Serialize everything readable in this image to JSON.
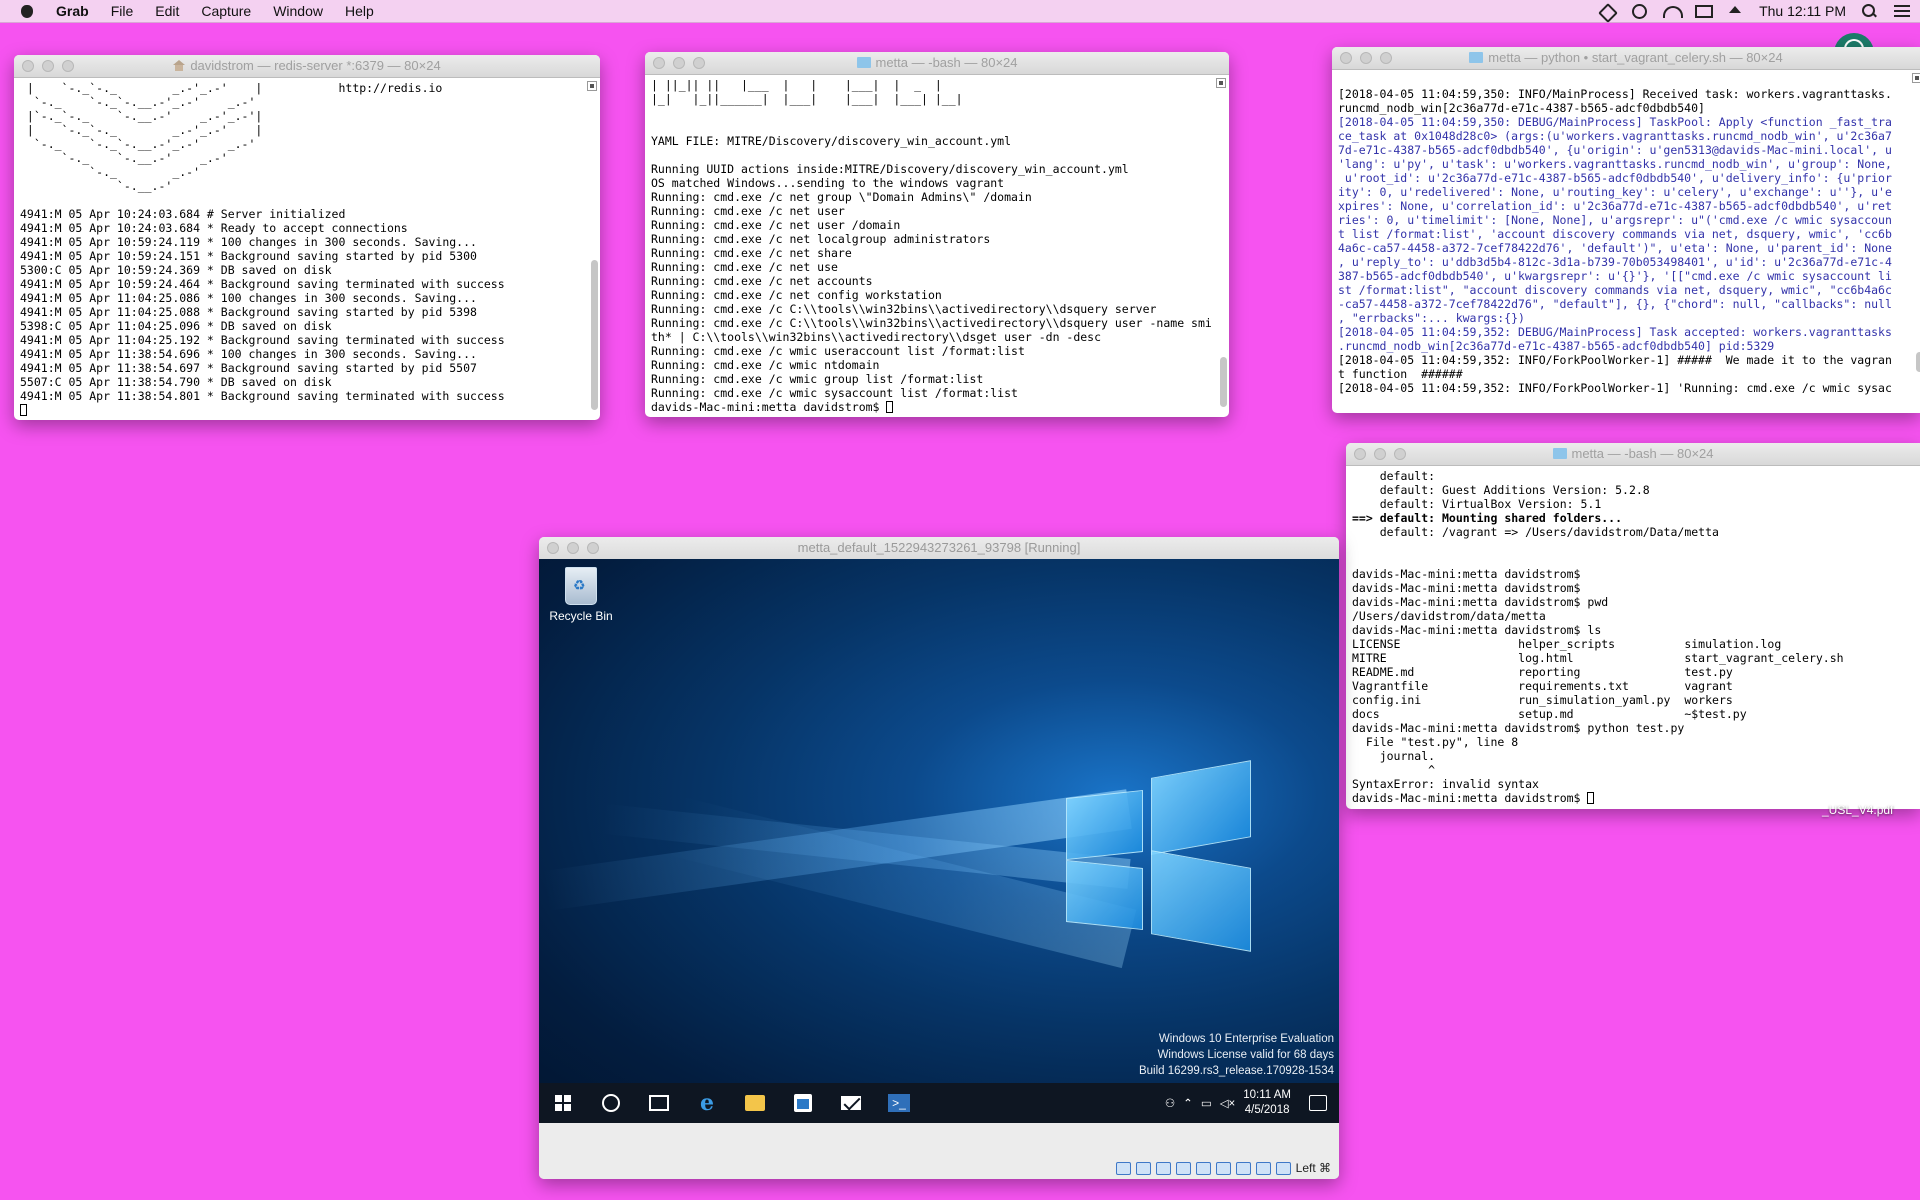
{
  "menubar": {
    "app_name": "Grab",
    "items": [
      "File",
      "Edit",
      "Capture",
      "Window",
      "Help"
    ],
    "clock": "Thu 12:11 PM"
  },
  "redis_window": {
    "title": "davidstrom — redis-server *:6379 — 80×24",
    "lines": [
      " |    `-._`-._        _.-'_.-'    |           http://redis.io        ",
      "  `-._    `-._`-.__.-'_.-'    _.-'",
      " |`-._`-._    `-.__.-'    _.-'_.-'|",
      " |    `-._`-._        _.-'_.-'    |",
      "  `-._    `-._`-.__.-'_.-'    _.-'",
      "      `-._    `-.__.-'    _.-'",
      "          `-._        _.-'",
      "              `-.__.-'",
      "",
      "4941:M 05 Apr 10:24:03.684 # Server initialized",
      "4941:M 05 Apr 10:24:03.684 * Ready to accept connections",
      "4941:M 05 Apr 10:59:24.119 * 100 changes in 300 seconds. Saving...",
      "4941:M 05 Apr 10:59:24.151 * Background saving started by pid 5300",
      "5300:C 05 Apr 10:59:24.369 * DB saved on disk",
      "4941:M 05 Apr 10:59:24.464 * Background saving terminated with success",
      "4941:M 05 Apr 11:04:25.086 * 100 changes in 300 seconds. Saving...",
      "4941:M 05 Apr 11:04:25.088 * Background saving started by pid 5398",
      "5398:C 05 Apr 11:04:25.096 * DB saved on disk",
      "4941:M 05 Apr 11:04:25.192 * Background saving terminated with success",
      "4941:M 05 Apr 11:38:54.696 * 100 changes in 300 seconds. Saving...",
      "4941:M 05 Apr 11:38:54.697 * Background saving started by pid 5507",
      "5507:C 05 Apr 11:38:54.790 * DB saved on disk",
      "4941:M 05 Apr 11:38:54.801 * Background saving terminated with success"
    ]
  },
  "bash_window_1": {
    "title": "metta — -bash — 80×24",
    "lines": [
      "| ||_|| ||   |___  |   |    |___|  |  _  |",
      "|_|   |_||______|  |___|    |___|  |___| |__|",
      "",
      "",
      "YAML FILE: MITRE/Discovery/discovery_win_account.yml",
      "",
      "Running UUID actions inside:MITRE/Discovery/discovery_win_account.yml",
      "OS matched Windows...sending to the windows vagrant",
      "Running: cmd.exe /c net group \\\"Domain Admins\\\" /domain",
      "Running: cmd.exe /c net user",
      "Running: cmd.exe /c net user /domain",
      "Running: cmd.exe /c net localgroup administrators",
      "Running: cmd.exe /c net share",
      "Running: cmd.exe /c net use",
      "Running: cmd.exe /c net accounts",
      "Running: cmd.exe /c net config workstation",
      "Running: cmd.exe /c C:\\\\tools\\\\win32bins\\\\activedirectory\\\\dsquery server",
      "Running: cmd.exe /c C:\\\\tools\\\\win32bins\\\\activedirectory\\\\dsquery user -name smi",
      "th* | C:\\\\tools\\\\win32bins\\\\activedirectory\\\\dsget user -dn -desc",
      "Running: cmd.exe /c wmic useraccount list /format:list",
      "Running: cmd.exe /c wmic ntdomain",
      "Running: cmd.exe /c wmic group list /format:list",
      "Running: cmd.exe /c wmic sysaccount list /format:list"
    ],
    "prompt": "davids-Mac-mini:metta davidstrom$ "
  },
  "python_window": {
    "title": "metta — python • start_vagrant_celery.sh — 80×24",
    "lines": [
      {
        "t": "",
        "c": ""
      },
      {
        "t": "[2018-04-05 11:04:59,350: INFO/MainProcess] Received task: workers.vagranttasks.",
        "c": ""
      },
      {
        "t": "runcmd_nodb_win[2c36a77d-e71c-4387-b565-adcf0dbdb540]",
        "c": ""
      },
      {
        "t": "[2018-04-05 11:04:59,350: DEBUG/MainProcess] TaskPool: Apply <function _fast_tra",
        "c": "blue"
      },
      {
        "t": "ce_task at 0x1048d28c0> (args:(u'workers.vagranttasks.runcmd_nodb_win', u'2c36a7",
        "c": "blue"
      },
      {
        "t": "7d-e71c-4387-b565-adcf0dbdb540', {u'origin': u'gen5313@davids-Mac-mini.local', u",
        "c": "blue"
      },
      {
        "t": "'lang': u'py', u'task': u'workers.vagranttasks.runcmd_nodb_win', u'group': None,",
        "c": "blue"
      },
      {
        "t": " u'root_id': u'2c36a77d-e71c-4387-b565-adcf0dbdb540', u'delivery_info': {u'prior",
        "c": "blue"
      },
      {
        "t": "ity': 0, u'redelivered': None, u'routing_key': u'celery', u'exchange': u''}, u'e",
        "c": "blue"
      },
      {
        "t": "xpires': None, u'correlation_id': u'2c36a77d-e71c-4387-b565-adcf0dbdb540', u'ret",
        "c": "blue"
      },
      {
        "t": "ries': 0, u'timelimit': [None, None], u'argsrepr': u\"('cmd.exe /c wmic sysaccoun",
        "c": "blue"
      },
      {
        "t": "t list /format:list', 'account discovery commands via net, dsquery, wmic', 'cc6b",
        "c": "blue"
      },
      {
        "t": "4a6c-ca57-4458-a372-7cef78422d76', 'default')\", u'eta': None, u'parent_id': None",
        "c": "blue"
      },
      {
        "t": ", u'reply_to': u'ddb3d5b4-812c-3d1a-b739-70b053498401', u'id': u'2c36a77d-e71c-4",
        "c": "blue"
      },
      {
        "t": "387-b565-adcf0dbdb540', u'kwargsrepr': u'{}'}, '[[\"cmd.exe /c wmic sysaccount li",
        "c": "blue"
      },
      {
        "t": "st /format:list\", \"account discovery commands via net, dsquery, wmic\", \"cc6b4a6c",
        "c": "blue"
      },
      {
        "t": "-ca57-4458-a372-7cef78422d76\", \"default\"], {}, {\"chord\": null, \"callbacks\": null",
        "c": "blue"
      },
      {
        "t": ", \"errbacks\":... kwargs:{})",
        "c": "blue"
      },
      {
        "t": "[2018-04-05 11:04:59,352: DEBUG/MainProcess] Task accepted: workers.vagranttasks",
        "c": "blue"
      },
      {
        "t": ".runcmd_nodb_win[2c36a77d-e71c-4387-b565-adcf0dbdb540] pid:5329",
        "c": "blue"
      },
      {
        "t": "[2018-04-05 11:04:59,352: INFO/ForkPoolWorker-1] #####  We made it to the vagran",
        "c": ""
      },
      {
        "t": "t function  ######",
        "c": ""
      },
      {
        "t": "[2018-04-05 11:04:59,352: INFO/ForkPoolWorker-1] 'Running: cmd.exe /c wmic sysac",
        "c": ""
      }
    ]
  },
  "bash_window_2": {
    "title": "metta — -bash — 80×24",
    "lines": [
      {
        "t": "    default:",
        "c": ""
      },
      {
        "t": "    default: Guest Additions Version: 5.2.8",
        "c": ""
      },
      {
        "t": "    default: VirtualBox Version: 5.1",
        "c": ""
      },
      {
        "t": "==> default: Mounting shared folders...",
        "c": "bold"
      },
      {
        "t": "    default: /vagrant => /Users/davidstrom/Data/metta",
        "c": ""
      },
      {
        "t": "",
        "c": ""
      },
      {
        "t": "",
        "c": ""
      },
      {
        "t": "davids-Mac-mini:metta davidstrom$",
        "c": ""
      },
      {
        "t": "davids-Mac-mini:metta davidstrom$",
        "c": ""
      },
      {
        "t": "davids-Mac-mini:metta davidstrom$ pwd",
        "c": ""
      },
      {
        "t": "/Users/davidstrom/data/metta",
        "c": ""
      },
      {
        "t": "davids-Mac-mini:metta davidstrom$ ls",
        "c": ""
      },
      {
        "t": "LICENSE                 helper_scripts          simulation.log",
        "c": ""
      },
      {
        "t": "MITRE                   log.html                start_vagrant_celery.sh",
        "c": ""
      },
      {
        "t": "README.md               reporting               test.py",
        "c": ""
      },
      {
        "t": "Vagrantfile             requirements.txt        vagrant",
        "c": ""
      },
      {
        "t": "config.ini              run_simulation_yaml.py  workers",
        "c": ""
      },
      {
        "t": "docs                    setup.md                ~$test.py",
        "c": ""
      },
      {
        "t": "davids-Mac-mini:metta davidstrom$ python test.py",
        "c": ""
      },
      {
        "t": "  File \"test.py\", line 8",
        "c": ""
      },
      {
        "t": "    journal.",
        "c": ""
      },
      {
        "t": "           ^",
        "c": ""
      },
      {
        "t": "SyntaxError: invalid syntax",
        "c": ""
      }
    ],
    "prompt": "davids-Mac-mini:metta davidstrom$ "
  },
  "vm_window": {
    "title": "metta_default_1522943273261_93798 [Running]",
    "recycle_bin_label": "Recycle Bin",
    "watermark": [
      "Windows 10 Enterprise Evaluation",
      "Windows License valid for 68 days",
      "Build 16299.rs3_release.170928-1534"
    ],
    "taskbar_time": "10:11 AM",
    "taskbar_date": "4/5/2018",
    "host_key": "Left ⌘"
  },
  "desktop_file_label": "_USL_V4.pdf"
}
